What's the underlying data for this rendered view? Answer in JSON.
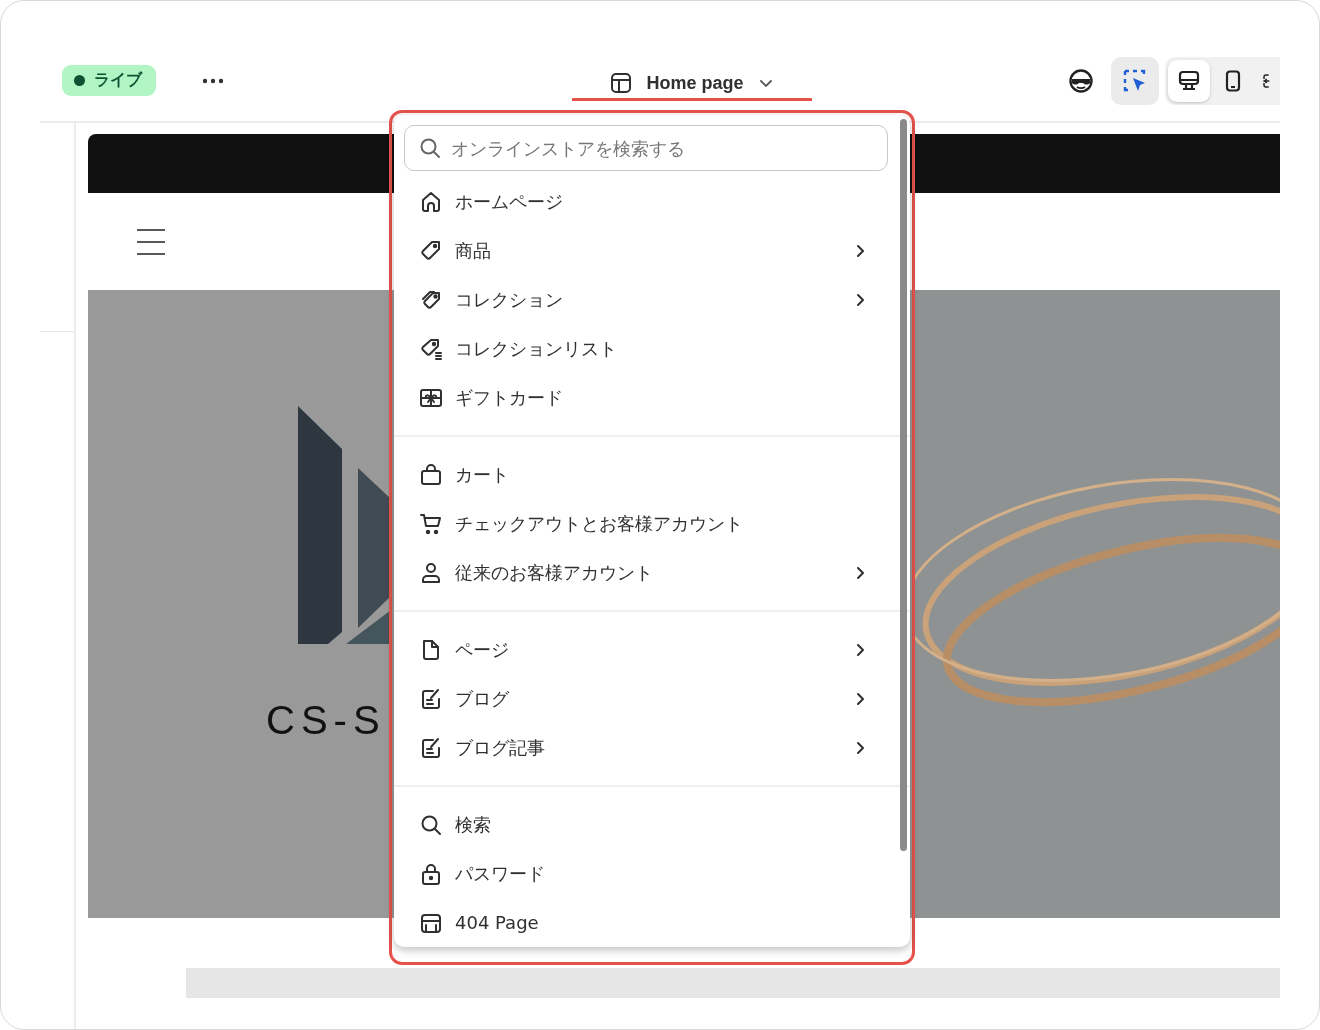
{
  "topbar": {
    "status_badge": {
      "label": "ライブ",
      "live": true
    },
    "page_selector": {
      "label": "Home page"
    },
    "view_tools": [
      {
        "kind": "preview",
        "selected": false
      },
      {
        "kind": "inspector",
        "selected": true
      }
    ],
    "devices": [
      {
        "kind": "desktop",
        "selected": true
      },
      {
        "kind": "mobile",
        "selected": false
      },
      {
        "kind": "fullscreen",
        "selected": false
      }
    ]
  },
  "preview": {
    "logo_text": "CS-S"
  },
  "dropdown": {
    "search": {
      "placeholder": "オンラインストアを検索する"
    },
    "groups": [
      {
        "items": [
          {
            "kind": "home",
            "label": "ホームページ",
            "submenu": false
          },
          {
            "kind": "product",
            "label": "商品",
            "submenu": true
          },
          {
            "kind": "collection",
            "label": "コレクション",
            "submenu": true
          },
          {
            "kind": "collections",
            "label": "コレクションリスト",
            "submenu": false
          },
          {
            "kind": "giftcard",
            "label": "ギフトカード",
            "submenu": false
          }
        ]
      },
      {
        "items": [
          {
            "kind": "cart",
            "label": "カート",
            "submenu": false
          },
          {
            "kind": "checkout",
            "label": "チェックアウトとお客様アカウント",
            "submenu": false
          },
          {
            "kind": "account",
            "label": "従来のお客様アカウント",
            "submenu": true
          }
        ]
      },
      {
        "items": [
          {
            "kind": "page",
            "label": "ページ",
            "submenu": true
          },
          {
            "kind": "blog",
            "label": "ブログ",
            "submenu": true
          },
          {
            "kind": "article",
            "label": "ブログ記事",
            "submenu": true
          }
        ]
      },
      {
        "items": [
          {
            "kind": "search",
            "label": "検索",
            "submenu": false
          },
          {
            "kind": "password",
            "label": "パスワード",
            "submenu": false
          },
          {
            "kind": "notfound",
            "label": "404 Page",
            "submenu": false
          }
        ]
      }
    ]
  }
}
